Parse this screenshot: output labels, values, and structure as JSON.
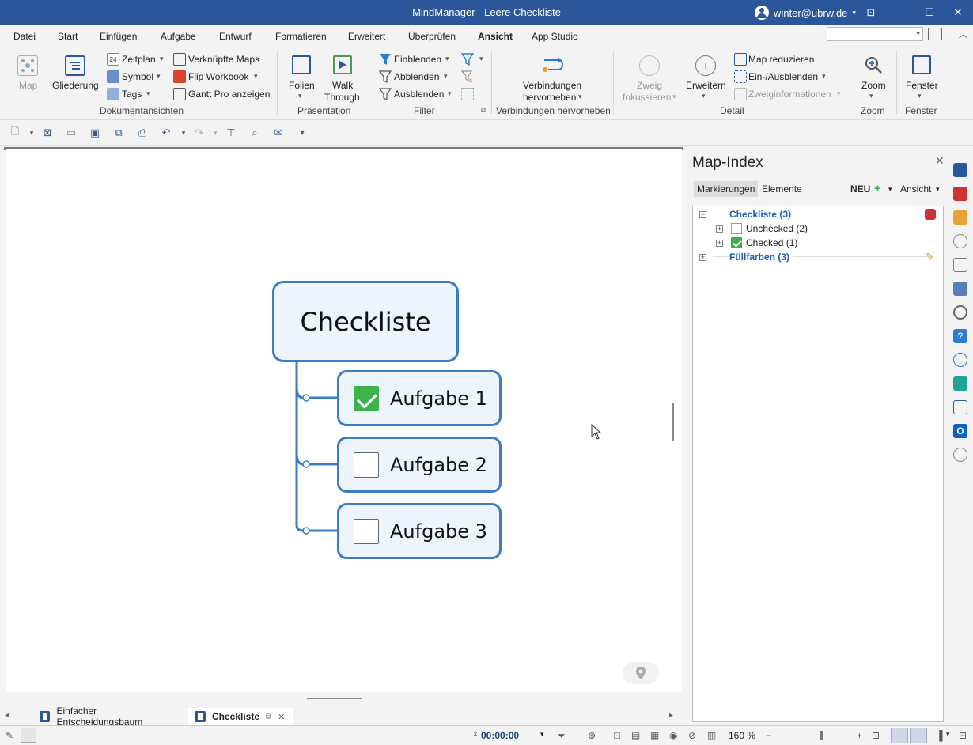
{
  "window": {
    "title": "MindManager - Leere Checkliste",
    "user": "winter@ubrw.de",
    "controls": {
      "minimize": "–",
      "maximize": "☐",
      "close": "✕"
    }
  },
  "menu": [
    "Datei",
    "Start",
    "Einfügen",
    "Aufgabe",
    "Entwurf",
    "Formatieren",
    "Erweitert",
    "Überprüfen",
    "Ansicht",
    "App Studio"
  ],
  "menu_active": "Ansicht",
  "ribbon": {
    "dokumentansichten": {
      "label": "Dokumentansichten",
      "map": "Map",
      "gliederung": "Gliederung",
      "zeitplan": "Zeitplan",
      "symbol": "Symbol",
      "tags": "Tags",
      "verknuepfte_maps": "Verknüpfte Maps",
      "flip_workbook": "Flip Workbook",
      "gantt_pro": "Gantt Pro anzeigen"
    },
    "praesentation": {
      "label": "Präsentation",
      "folien": "Folien",
      "walk": "Walk",
      "through": "Through"
    },
    "filter": {
      "label": "Filter",
      "einblenden": "Einblenden",
      "abblenden": "Abblenden",
      "ausblenden": "Ausblenden"
    },
    "verbindungen": {
      "label": "Verbindungen hervorheben",
      "line1": "Verbindungen",
      "line2": "hervorheben"
    },
    "detail": {
      "label": "Detail",
      "zweig": "Zweig",
      "fokussieren": "fokussieren",
      "erweitern": "Erweitern",
      "map_reduzieren": "Map reduzieren",
      "ein_ausblenden": "Ein-/Ausblenden",
      "zweiginformationen": "Zweiginformationen"
    },
    "zoom": {
      "label": "Zoom",
      "button": "Zoom"
    },
    "fenster": {
      "label": "Fenster",
      "button": "Fenster"
    }
  },
  "map": {
    "central": "Checkliste",
    "tasks": [
      {
        "label": "Aufgabe 1",
        "checked": true
      },
      {
        "label": "Aufgabe 2",
        "checked": false
      },
      {
        "label": "Aufgabe 3",
        "checked": false
      }
    ]
  },
  "doc_tabs": [
    {
      "label": "Einfacher Entscheidungsbaum",
      "active": false
    },
    {
      "label": "Checkliste",
      "active": true
    }
  ],
  "panel": {
    "title": "Map-Index",
    "tab_markierungen": "Markierungen",
    "tab_elemente": "Elemente",
    "neu": "NEU",
    "ansicht": "Ansicht",
    "tree": {
      "checkliste": "Checkliste (3)",
      "unchecked": "Unchecked (2)",
      "checked": "Checked (1)",
      "fuellfarben": "Füllfarben (3)"
    }
  },
  "status": {
    "timer": "00:00:00",
    "zoom": "160 %"
  },
  "colors": {
    "titlebar": "#2b579a",
    "node_border": "#3b7dc2",
    "node_fill": "#eef4fc",
    "check_green": "#3cb34a",
    "link_blue": "#1a5fb4"
  }
}
